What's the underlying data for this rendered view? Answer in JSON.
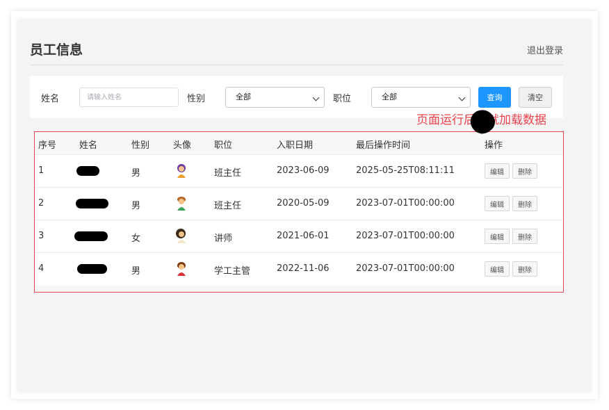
{
  "header": {
    "title": "员工信息",
    "logout_label": "退出登录"
  },
  "search": {
    "name_label": "姓名",
    "name_placeholder": "请输入姓名",
    "name_value": "",
    "gender_label": "性别",
    "gender_selected": "全部",
    "job_label": "职位",
    "job_selected": "全部",
    "query_label": "查询",
    "clear_label": "清空"
  },
  "annotation": {
    "text": "页面运行后，就加载数据",
    "color": "#e8434c"
  },
  "table": {
    "columns": [
      "序号",
      "姓名",
      "性别",
      "头像",
      "职位",
      "入职日期",
      "最后操作时间",
      "操作"
    ],
    "rows": [
      {
        "index": "1",
        "gender": "男",
        "avatar": "avatar-icon",
        "job": "班主任",
        "entry_date": "2023-06-09",
        "update_time": "2025-05-25T08:11:11",
        "edit_label": "编辑",
        "delete_label": "删除"
      },
      {
        "index": "2",
        "gender": "男",
        "avatar": "avatar-icon",
        "job": "班主任",
        "entry_date": "2020-05-09",
        "update_time": "2023-07-01T00:00:00",
        "edit_label": "编辑",
        "delete_label": "删除"
      },
      {
        "index": "3",
        "gender": "女",
        "avatar": "avatar-icon",
        "job": "讲师",
        "entry_date": "2021-06-01",
        "update_time": "2023-07-01T00:00:00",
        "edit_label": "编辑",
        "delete_label": "删除"
      },
      {
        "index": "4",
        "gender": "男",
        "avatar": "avatar-icon",
        "job": "学工主管",
        "entry_date": "2022-11-06",
        "update_time": "2023-07-01T00:00:00",
        "edit_label": "编辑",
        "delete_label": "删除"
      }
    ]
  },
  "colors": {
    "accent": "#1e96ff",
    "highlight": "#e8434c",
    "panel_background": "#f4f4f4"
  }
}
